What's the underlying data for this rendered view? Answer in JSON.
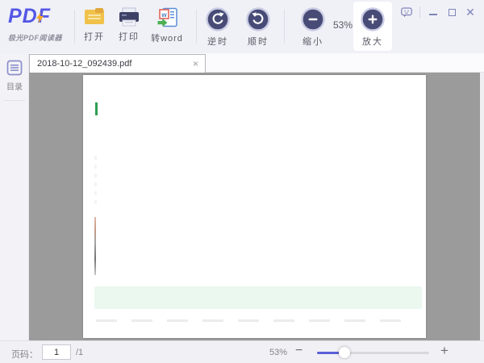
{
  "toolbar": {
    "logo_title": "PDF",
    "logo_subtitle": "极光PDF阅读器",
    "open_label": "打开",
    "print_label": "打印",
    "to_word_label": "转word",
    "rotate_ccw_label": "逆时",
    "rotate_cw_label": "顺时",
    "zoom_out_label": "缩小",
    "zoom_level": "53%",
    "zoom_in_label": "放大"
  },
  "window_controls": {
    "feedback_icon": "speech-bubble",
    "minimize_icon": "minimize-bar",
    "maximize_icon": "maximize-square",
    "close_glyph": "✕"
  },
  "tabbar": {
    "tab_title": "2018-10-12_092439.pdf",
    "tab_close_glyph": "×"
  },
  "sidebar": {
    "toc_label": "目录"
  },
  "document": {
    "page_background": "#ffffff",
    "viewport_background": "#9b9b9b",
    "annotations": {
      "green_marker": "#2f9e50",
      "highlight_band": "#eaf8ef"
    }
  },
  "statusbar": {
    "page_label": "页码：",
    "page_value": "1",
    "page_total": "/1",
    "zoom_value": "53%",
    "zoom_out_glyph": "−",
    "zoom_in_glyph": "+",
    "slider_fill_percent": 24
  },
  "colors": {
    "accent": "#5457e5",
    "icon_dark": "#474b76",
    "icon_ring": "#c9cbe4",
    "bolt_yellow": "#f6a824",
    "folder_yellow": "#f0c24b",
    "printer_navy": "#3d4166",
    "word_green": "#4caf50",
    "word_red": "#e05a4e"
  }
}
